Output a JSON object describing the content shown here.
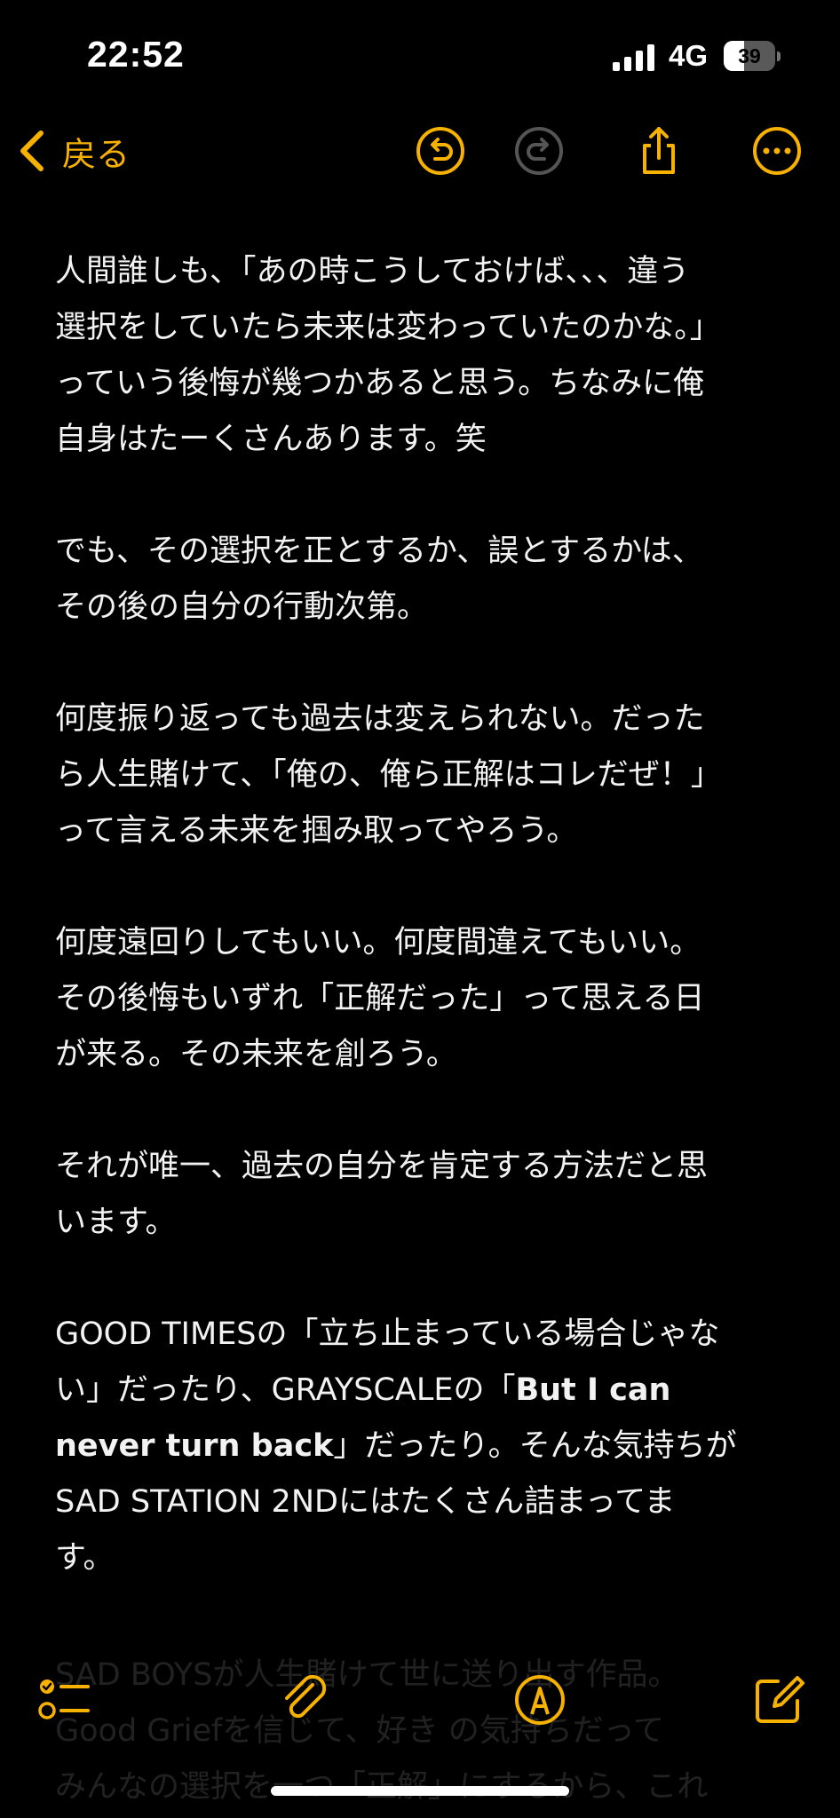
{
  "status_bar": {
    "time": "22:52",
    "network": "4G",
    "battery_level": 39,
    "battery_label": "39"
  },
  "nav": {
    "back_label": "戻る"
  },
  "note": {
    "paragraphs": [
      {
        "lines": [
          "人間誰しも、「あの時こうしておけば、、、違う",
          "選択をしていたら未来は変わっていたのかな。」",
          "っていう後悔が幾つかあると思う。ちなみに俺",
          "自身はたーくさんあります。笑"
        ]
      },
      {
        "lines": [
          "でも、その選択を正とするか、誤とするかは、",
          "その後の自分の行動次第。"
        ]
      },
      {
        "lines": [
          "何度振り返っても過去は変えられない。だった",
          "ら人生賭けて、「俺の、俺ら正解はコレだぜ！」",
          "って言える未来を掴み取ってやろう。"
        ]
      },
      {
        "lines": [
          "何度遠回りしてもいい。何度間違えてもいい。",
          "その後悔もいずれ「正解だった」って思える日",
          "が来る。その未来を創ろう。"
        ]
      },
      {
        "lines": [
          "それが唯一、過去の自分を肯定する方法だと思",
          "います。"
        ]
      }
    ],
    "last": {
      "l1": "GOOD TIMESの「立ち止まっている場合じゃな",
      "l2a": "い」だったり、GRAYSCALEの「",
      "l2b": "But I can",
      "l3a": "never turn back",
      "l3b": "」だったり。そんな気持ちが",
      "l4": "SAD STATION 2NDにはたくさん詰まってま",
      "l5": "す。"
    },
    "faded_lines": [
      "SAD BOYSが人生賭けて世に送り出す作品。",
      "Good Griefを信じて、好き の気持ちだって",
      "みんなの選択を一つ「正解」にするから、これ"
    ]
  },
  "colors": {
    "accent": "#f7b200",
    "background": "#000000",
    "text": "#f2f2f2"
  }
}
